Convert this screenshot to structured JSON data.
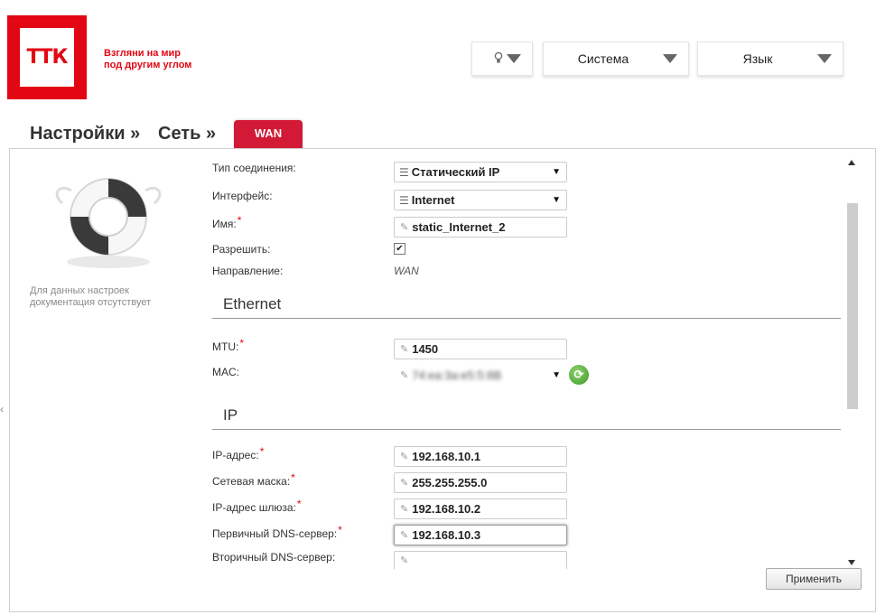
{
  "brand": {
    "logo_text": "ТТК",
    "slogan_line1": "Взгляни на мир",
    "slogan_line2": "под другим углом"
  },
  "header": {
    "hint_icon": "lightbulb-icon",
    "system_label": "Система",
    "language_label": "Язык"
  },
  "breadcrumb": {
    "settings": "Настройки »",
    "network": "Сеть »",
    "current_tab": "WAN"
  },
  "help": {
    "icon": "lifebuoy-icon",
    "text_line1": "Для данных настроек",
    "text_line2": "документация отсутствует"
  },
  "form": {
    "connection_type": {
      "label": "Тип соединения:",
      "value": "Статический IP"
    },
    "interface": {
      "label": "Интерфейс:",
      "value": "Internet"
    },
    "name": {
      "label": "Имя:",
      "required": "*",
      "value": "static_Internet_2"
    },
    "enable": {
      "label": "Разрешить:",
      "checked": true,
      "check_mark": "✔"
    },
    "direction": {
      "label": "Направление:",
      "value": "WAN"
    }
  },
  "ethernet": {
    "title": "Ethernet",
    "mtu": {
      "label": "MTU:",
      "required": "*",
      "value": "1450"
    },
    "mac": {
      "label": "MAC:",
      "value": "74:ea:3a:e5:5:8B"
    }
  },
  "ip": {
    "title": "IP",
    "address": {
      "label": "IP-адрес:",
      "required": "*",
      "value": "192.168.10.1"
    },
    "netmask": {
      "label": "Сетевая маска:",
      "required": "*",
      "value": "255.255.255.0"
    },
    "gateway": {
      "label": "IP-адрес шлюза:",
      "required": "*",
      "value": "192.168.10.2"
    },
    "dns1": {
      "label": "Первичный DNS-сервер:",
      "required": "*",
      "value": "192.168.10.3"
    },
    "dns2": {
      "label": "Вторичный DNS-сервер:",
      "value": ""
    }
  },
  "actions": {
    "apply_label": "Применить"
  },
  "colors": {
    "brand_red": "#e30613",
    "tab_red": "#d21a36"
  }
}
